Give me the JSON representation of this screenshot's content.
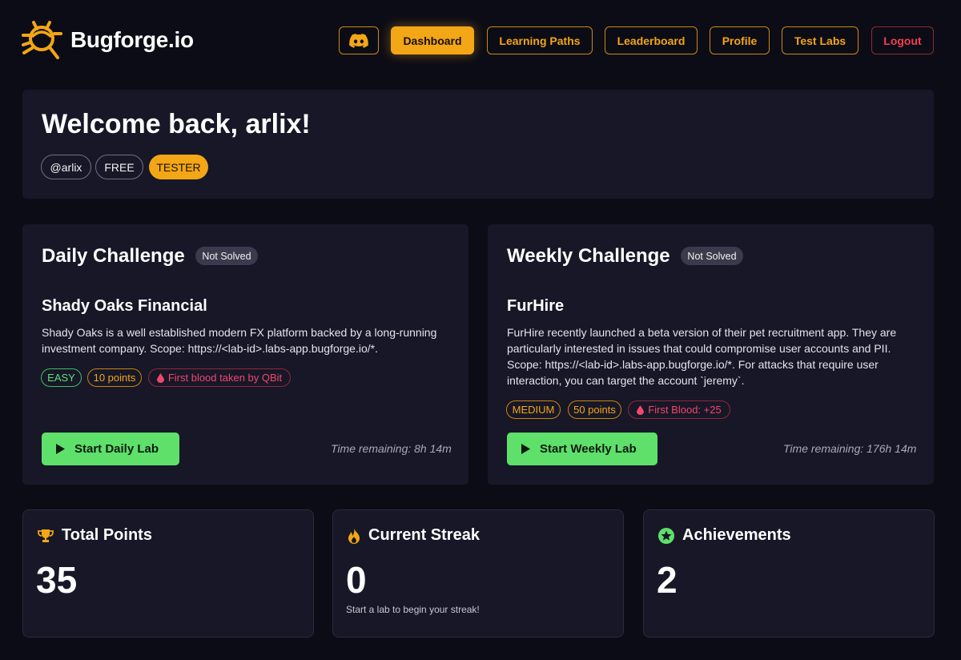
{
  "brand": {
    "name": "Bugforge.io"
  },
  "nav": {
    "discord_icon": "discord-icon",
    "items": [
      "Dashboard",
      "Learning Paths",
      "Leaderboard",
      "Profile",
      "Test Labs"
    ],
    "logout": "Logout",
    "active": "Dashboard"
  },
  "welcome": {
    "title": "Welcome back, arlix!",
    "handle": "@arlix",
    "plan": "FREE",
    "role": "TESTER"
  },
  "daily": {
    "heading": "Daily Challenge",
    "status": "Not Solved",
    "lab_name": "Shady Oaks Financial",
    "description": "Shady Oaks is a well established modern FX platform backed by a long-running investment company. Scope: https://<lab-id>.labs-app.bugforge.io/*.",
    "difficulty": "EASY",
    "points": "10 points",
    "blood": "First blood taken by QBit",
    "button": "Start Daily Lab",
    "time_remaining": "Time remaining: 8h 14m"
  },
  "weekly": {
    "heading": "Weekly Challenge",
    "status": "Not Solved",
    "lab_name": "FurHire",
    "description": "FurHire recently launched a beta version of their pet recruitment app. They are particularly interested in issues that could compromise user accounts and PII. Scope: https://<lab-id>.labs-app.bugforge.io/*. For attacks that require user interaction, you can target the account `jeremy`.",
    "difficulty": "MEDIUM",
    "points": "50 points",
    "blood": "First Blood: +25",
    "button": "Start Weekly Lab",
    "time_remaining": "Time remaining: 176h 14m"
  },
  "stats": {
    "total_points": {
      "title": "Total Points",
      "value": "35",
      "icon": "trophy-icon"
    },
    "current_streak": {
      "title": "Current Streak",
      "value": "0",
      "note": "Start a lab to begin your streak!",
      "icon": "flame-icon"
    },
    "achievements": {
      "title": "Achievements",
      "value": "2",
      "icon": "star-badge-icon"
    }
  },
  "colors": {
    "accent": "#f3a616",
    "background": "#0c0c16",
    "card": "#171727",
    "success": "#5ee06b",
    "danger": "#f4404e"
  }
}
